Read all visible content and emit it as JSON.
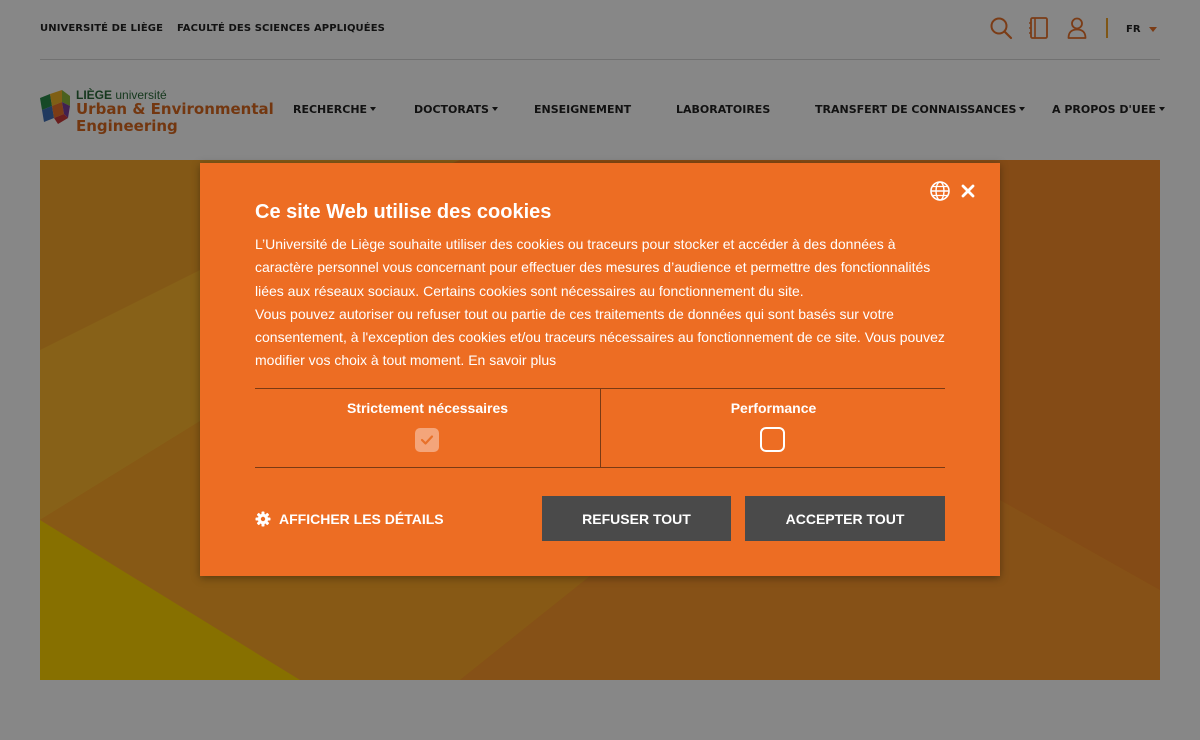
{
  "topbar": {
    "links": [
      "UNIVERSITÉ DE LIÈGE",
      "FACULTÉ DES SCIENCES APPLIQUÉES"
    ],
    "icons": [
      "search-icon",
      "book-icon",
      "user-icon"
    ],
    "language": "FR"
  },
  "header": {
    "logo": {
      "brand_bold": "LIÈGE",
      "brand_rest": "université",
      "line1": "Urban & Environmental",
      "line2": "Engineering"
    },
    "nav": [
      "RECHERCHE",
      "DOCTORATS",
      "ENSEIGNEMENT",
      "LABORATOIRES",
      "TRANSFERT DE CONNAISSANCES",
      "A PROPOS D'UEE"
    ]
  },
  "cookie_modal": {
    "title": "Ce site Web utilise des cookies",
    "paragraph1": "L’Université de Liège souhaite utiliser des cookies ou traceurs pour stocker et accéder à des données à caractère personnel vous concernant pour effectuer des mesures d’audience et permettre des fonctionnalités liées aux réseaux sociaux. Certains cookies sont nécessaires au fonctionnement du site.",
    "paragraph2": "Vous pouvez autoriser ou refuser tout ou partie de ces traitements de données qui sont basés sur votre consentement, à l'exception des cookies et/ou traceurs nécessaires au fonctionnement de ce site. Vous pouvez modifier vos choix à tout moment.",
    "learn_more": "En savoir plus",
    "categories": [
      {
        "label": "Strictement nécessaires",
        "checked": true,
        "disabled": true
      },
      {
        "label": "Performance",
        "checked": false,
        "disabled": false
      }
    ],
    "details_label": "AFFICHER LES DÉTAILS",
    "refuse_label": "REFUSER TOUT",
    "accept_label": "ACCEPTER TOUT",
    "colors": {
      "accent": "#ed6d23",
      "button": "#4a4a4a"
    }
  }
}
